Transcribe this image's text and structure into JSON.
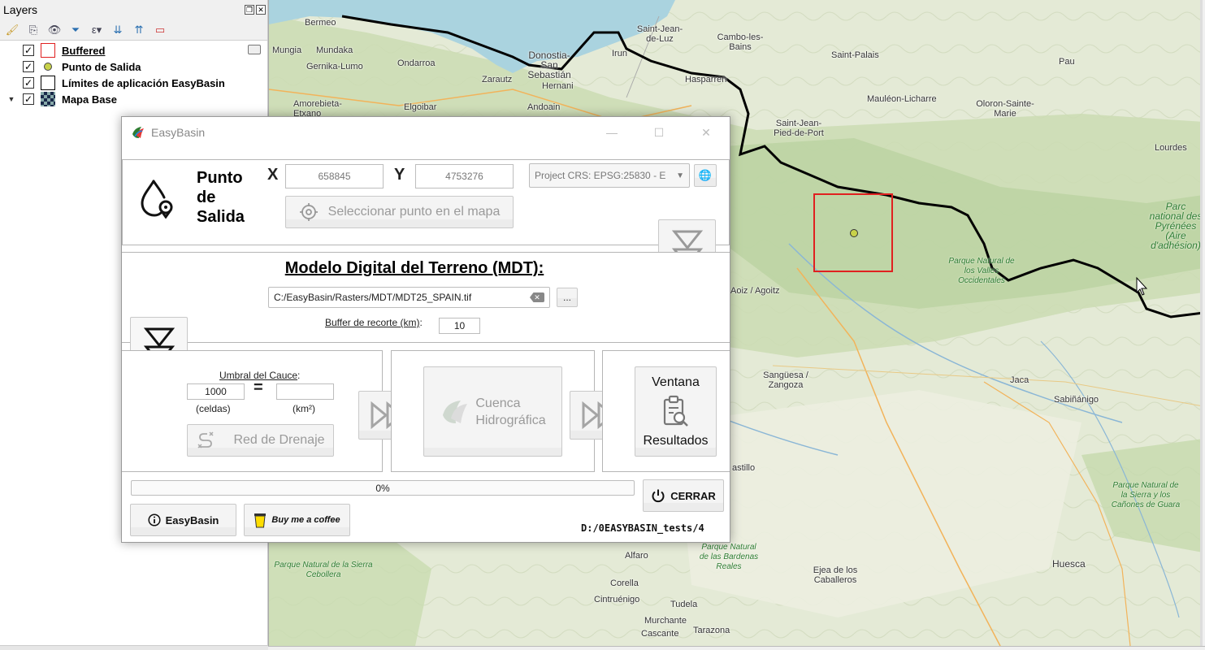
{
  "layers_panel": {
    "title": "Layers",
    "items": [
      {
        "name": "Buffered",
        "checked": true,
        "symbol": "red-outline-polygon"
      },
      {
        "name": "Punto de Salida",
        "checked": true,
        "symbol": "yellow-point"
      },
      {
        "name": "Límites de aplicación EasyBasin",
        "checked": true,
        "symbol": "black-outline-polygon"
      },
      {
        "name": "Mapa Base",
        "checked": true,
        "symbol": "raster",
        "expanded": true
      }
    ]
  },
  "map": {
    "places": {
      "bermeo": "Bermeo",
      "mungia": "Mungia",
      "mundaka": "Mundaka",
      "gernika": "Gernika-Lumo",
      "ondarroa": "Ondarroa",
      "donostia": "Donostia-San Sebastián",
      "stjean_luz": "Saint-Jean-de-Luz",
      "cambo": "Cambo-les-Bains",
      "saint_palais": "Saint-Palais",
      "pau": "Pau",
      "zarautz": "Zarautz",
      "hernani": "Hernani",
      "irun": "Irun",
      "hasparren": "Hasparren",
      "amorebieta": "Amorebieta-Etxano",
      "elgoibar": "Elgoibar",
      "andoain": "Andoain",
      "mauleon": "Mauléon-Licharre",
      "oloron": "Oloron-Sainte-Marie",
      "stjean_pied": "Saint-Jean-Pied-de-Port",
      "lourdes": "Lourdes",
      "aoiz": "Aoiz / Agoitz",
      "sanguesa": "Sangüesa / Zangoza",
      "jaca": "Jaca",
      "sabinanigo": "Sabiñánigo",
      "castillo": "astillo",
      "alfaro": "Alfaro",
      "corella": "Corella",
      "cintruenigo": "Cintruénigo",
      "tudela": "Tudela",
      "murchante": "Murchante",
      "cascante": "Cascante",
      "tarazona": "Tarazona",
      "ejea": "Ejea de los Caballeros",
      "huesca": "Huesca"
    },
    "parks": {
      "pyrenees": "Parc national des Pyrénées (Aire d'adhésion)",
      "valles": "Parque Natural de los Valles Occidentales",
      "bardenas": "Parque Natural de las Bardenas Reales",
      "sierra_guara": "Parque Natural de la Sierra y los Cañones de Guara",
      "sierra_cebollera": "Parque Natural de la Sierra Cebollera"
    }
  },
  "dialog": {
    "title": "EasyBasin",
    "outlet": {
      "heading": "Punto de Salida",
      "x_label": "X",
      "x_value": "658845",
      "y_label": "Y",
      "y_value": "4753276",
      "crs": "Project CRS: EPSG:25830 - E",
      "select_button": "Seleccionar punto en el mapa"
    },
    "mdt": {
      "heading": "Modelo Digital del Terreno (MDT):",
      "path": "C:/EasyBasin/Rasters/MDT/MDT25_SPAIN.tif",
      "browse_label": "...",
      "buffer_label": "Buffer de recorte (km)",
      "buffer_colon": ":",
      "buffer_value": "10"
    },
    "threshold": {
      "label": "Umbral del Cauce",
      "colon": ":",
      "cells_value": "1000",
      "equals": "=",
      "km2_value": "",
      "cells_unit": "(celdas)",
      "km2_unit": "(km²)"
    },
    "buttons": {
      "red_drenaje": "Red de Drenaje",
      "cuenca_line1": "Cuenca",
      "cuenca_line2": "Hidrográfica",
      "resultados_top": "Ventana",
      "resultados_bottom": "Resultados",
      "cerrar": "CERRAR",
      "easybasin": "EasyBasin",
      "coffee": "Buy me a coffee"
    },
    "progress": {
      "value": 0,
      "text": "0%"
    },
    "output_path": "D:/0EASYBASIN_tests/4"
  },
  "colors": {
    "buffer_outline": "#e02020",
    "outlet_point": "#c8d24a",
    "sea": "#aad3df",
    "border": "#000000"
  }
}
